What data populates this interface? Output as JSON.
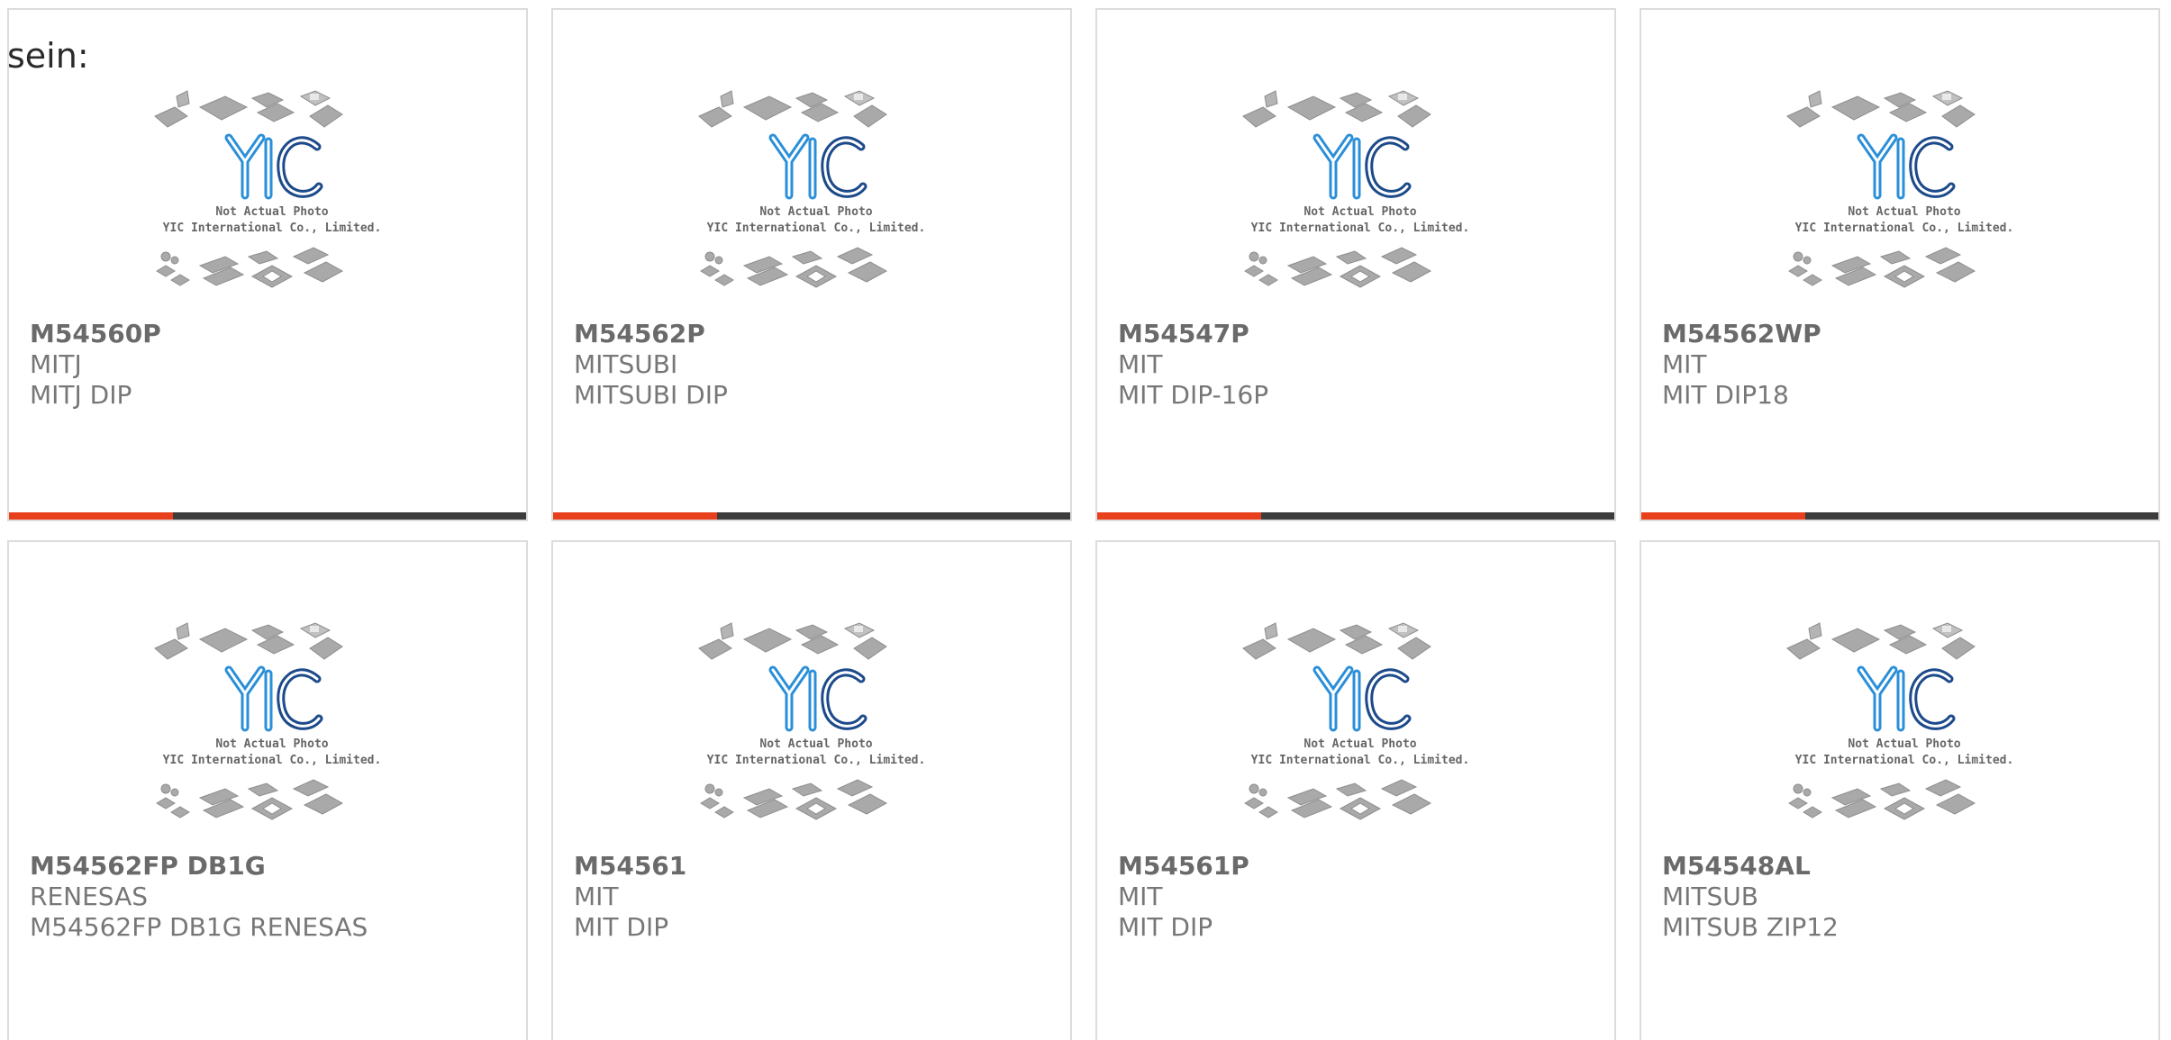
{
  "heading": "sein:",
  "colors": {
    "accent": "#e8401c",
    "bar": "#3c3c3c",
    "text": "#777777",
    "logo_blue": "#2a8fd8",
    "logo_dark": "#1c4a8a"
  },
  "placeholder": {
    "line1": "Not Actual Photo",
    "line2": "YIC International Co., Limited.",
    "logo_letters": "YIC"
  },
  "products": [
    {
      "part": "M54560P",
      "maker": "MITJ",
      "desc": "MITJ DIP"
    },
    {
      "part": "M54562P",
      "maker": "MITSUBI",
      "desc": "MITSUBI DIP"
    },
    {
      "part": "M54547P",
      "maker": "MIT",
      "desc": "MIT DIP-16P"
    },
    {
      "part": "M54562WP",
      "maker": "MIT",
      "desc": "MIT DIP18"
    },
    {
      "part": "M54562FP DB1G",
      "maker": "RENESAS",
      "desc": "M54562FP DB1G RENESAS"
    },
    {
      "part": "M54561",
      "maker": "MIT",
      "desc": "MIT DIP"
    },
    {
      "part": "M54561P",
      "maker": "MIT",
      "desc": "MIT DIP"
    },
    {
      "part": "M54548AL",
      "maker": "MITSUB",
      "desc": "MITSUB ZIP12"
    }
  ]
}
